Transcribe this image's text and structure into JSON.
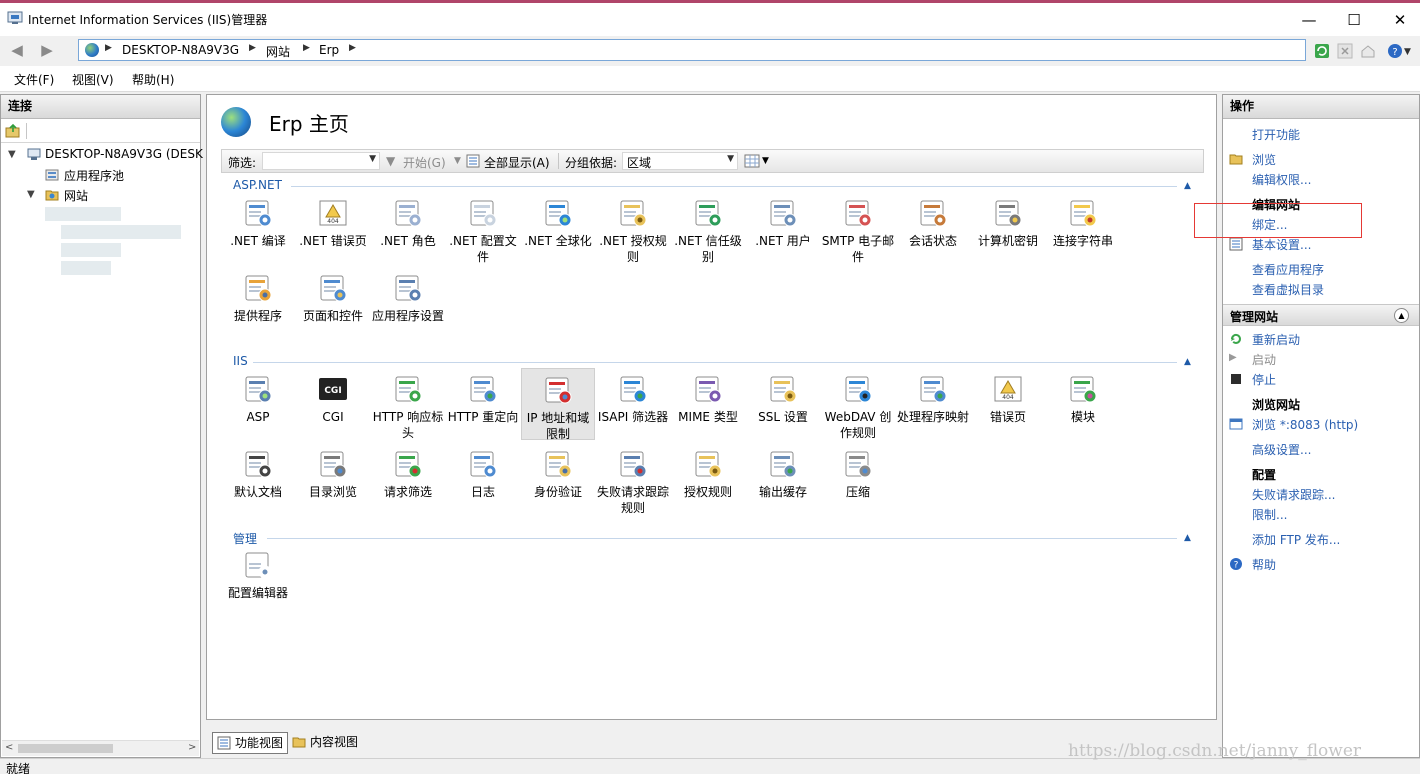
{
  "window": {
    "title": "Internet Information Services (IIS)管理器",
    "minimize": "—",
    "maximize": "☐",
    "close": "✕"
  },
  "address": {
    "crumbs": [
      "DESKTOP-N8A9V3G",
      "网站",
      "Erp"
    ]
  },
  "menu": [
    "文件(F)",
    "视图(V)",
    "帮助(H)"
  ],
  "connections": {
    "title": "连接",
    "tree": {
      "server": "DESKTOP-N8A9V3G (DESK",
      "app_pools": "应用程序池",
      "sites": "网站"
    }
  },
  "page": {
    "title": "Erp 主页"
  },
  "filter": {
    "label": "筛选:",
    "go": "开始(G)",
    "show_all": "全部显示(A)",
    "group_by": "分组依据:",
    "group_value": "区域"
  },
  "sections": [
    {
      "title": "ASP.NET",
      "items": [
        ".NET 编译",
        ".NET 错误页",
        ".NET 角色",
        ".NET 配置文件",
        ".NET 全球化",
        ".NET 授权规则",
        ".NET 信任级别",
        ".NET 用户",
        "SMTP 电子邮件",
        "会话状态",
        "计算机密钥",
        "连接字符串",
        "提供程序",
        "页面和控件",
        "应用程序设置"
      ]
    },
    {
      "title": "IIS",
      "items": [
        "ASP",
        "CGI",
        "HTTP 响应标头",
        "HTTP 重定向",
        "IP 地址和域限制",
        "ISAPI 筛选器",
        "MIME 类型",
        "SSL 设置",
        "WebDAV 创作规则",
        "处理程序映射",
        "错误页",
        "模块",
        "默认文档",
        "目录浏览",
        "请求筛选",
        "日志",
        "身份验证",
        "失败请求跟踪规则",
        "授权规则",
        "输出缓存",
        "压缩"
      ]
    },
    {
      "title": "管理",
      "items": [
        "配置编辑器"
      ]
    }
  ],
  "bottom_tabs": {
    "features": "功能视图",
    "content": "内容视图"
  },
  "actions": {
    "title": "操作",
    "open_feature": "打开功能",
    "browse": "浏览",
    "edit_permissions": "编辑权限...",
    "edit_site": "编辑网站",
    "bindings": "绑定...",
    "basic_settings": "基本设置...",
    "view_apps": "查看应用程序",
    "view_vdirs": "查看虚拟目录",
    "manage_site": "管理网站",
    "restart": "重新启动",
    "start": "启动",
    "stop": "停止",
    "browse_site": "浏览网站",
    "browse_http": "浏览 *:8083 (http)",
    "advanced_settings": "高级设置...",
    "configure": "配置",
    "failed_tracing": "失败请求跟踪...",
    "limits": "限制...",
    "add_ftp": "添加 FTP 发布...",
    "help": "帮助"
  },
  "status": {
    "text": "就绪"
  },
  "watermark": "https://blog.csdn.net/janny_flower",
  "colors": {
    "link": "#2a5fb0",
    "section": "#1e5aa8",
    "highlight": "#e53935"
  }
}
